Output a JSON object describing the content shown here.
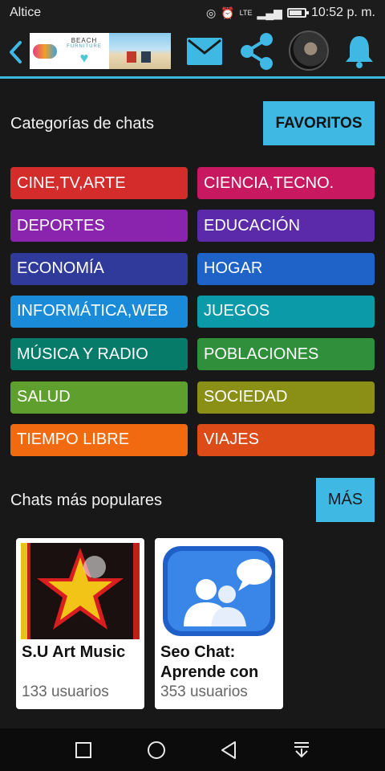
{
  "status": {
    "carrier": "Altice",
    "time": "10:52 p. m.",
    "network": "LTE",
    "battery_level": 0.85
  },
  "appbar": {
    "icons": [
      "back-arrow-icon",
      "mail-icon",
      "share-icon",
      "bell-icon"
    ],
    "ad": {
      "brand": "BEACH",
      "subbrand": "FURNITURE"
    }
  },
  "categories_section": {
    "title": "Categorías de chats",
    "favorites_label": "FAVORITOS",
    "items": [
      {
        "label": "CINE,TV,ARTE",
        "color": "#d42b2b"
      },
      {
        "label": "CIENCIA,TECNO.",
        "color": "#c8185f"
      },
      {
        "label": "DEPORTES",
        "color": "#8a23ad"
      },
      {
        "label": "EDUCACIÓN",
        "color": "#5a2aab"
      },
      {
        "label": "ECONOMÍA",
        "color": "#2f3a9a"
      },
      {
        "label": "HOGAR",
        "color": "#1f63c8"
      },
      {
        "label": "INFORMÁTICA,WEB",
        "color": "#1a8bd8"
      },
      {
        "label": "JUEGOS",
        "color": "#0a9aa8"
      },
      {
        "label": "MÚSICA Y RADIO",
        "color": "#067b6a"
      },
      {
        "label": "POBLACIONES",
        "color": "#2f8f3a"
      },
      {
        "label": "SALUD",
        "color": "#5e9f2e"
      },
      {
        "label": "SOCIEDAD",
        "color": "#8a8f16"
      },
      {
        "label": "TIEMPO LIBRE",
        "color": "#f16a10"
      },
      {
        "label": "VIAJES",
        "color": "#dd4c18"
      }
    ]
  },
  "popular_section": {
    "title": "Chats más populares",
    "more_label": "MÁS",
    "cards": [
      {
        "name": "S.U Art Music",
        "users": "133 usuarios"
      },
      {
        "name": "Seo Chat: Aprende con",
        "users": "353 usuarios"
      }
    ]
  },
  "navbar": {
    "icons": [
      "recent-apps-icon",
      "home-icon",
      "back-icon",
      "notifications-pull-icon"
    ]
  },
  "colors": {
    "accent": "#3fb8e4",
    "background": "#181818"
  }
}
